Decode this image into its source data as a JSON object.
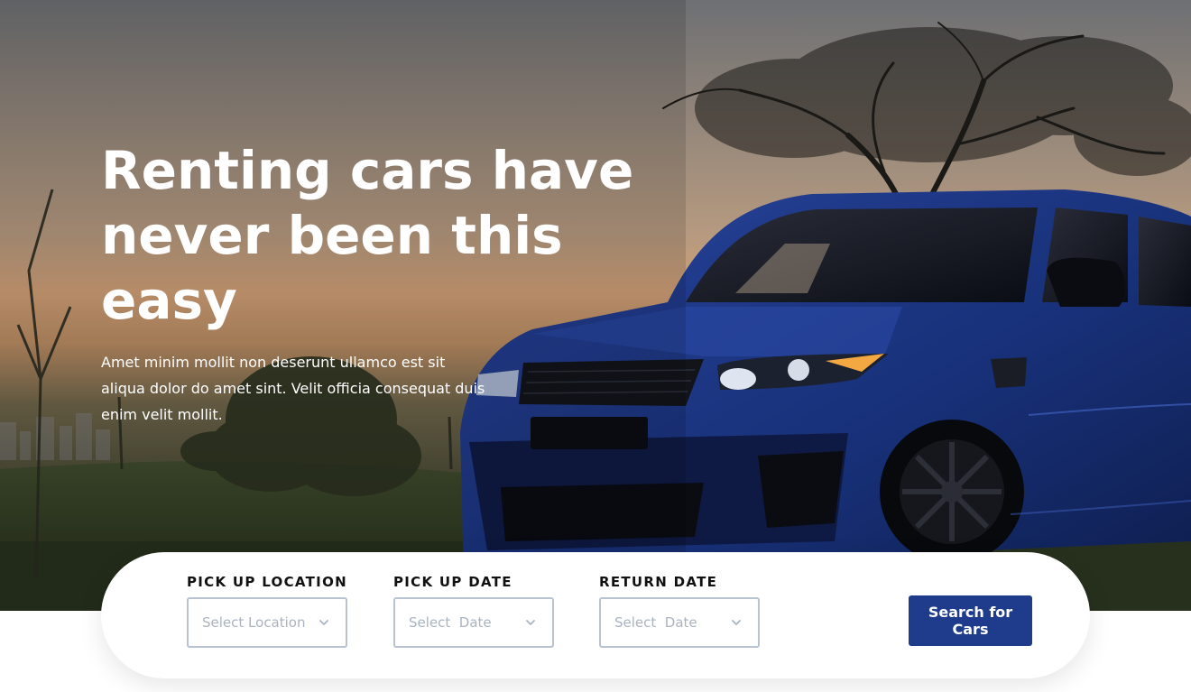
{
  "hero": {
    "title": "Renting cars have\nnever been this easy",
    "subtitle": "Amet minim mollit non deserunt ullamco est sit aliqua dolor do amet sint. Velit officia consequat duis enim velit mollit."
  },
  "search": {
    "fields": [
      {
        "label": "PICK UP LOCATION",
        "placeholder": "Select Location",
        "icon": "chevron-down-icon"
      },
      {
        "label": "PICK UP DATE",
        "placeholder": "Select  Date",
        "icon": "chevron-down-icon"
      },
      {
        "label": "RETURN DATE",
        "placeholder": "Select  Date",
        "icon": "chevron-down-icon"
      }
    ],
    "button_label": "Search for Cars"
  },
  "colors": {
    "accent": "#1f3b8c",
    "field_border": "#b8c2d0",
    "placeholder": "#a9b3c1",
    "label": "#111111",
    "hero_text": "#ffffff"
  }
}
